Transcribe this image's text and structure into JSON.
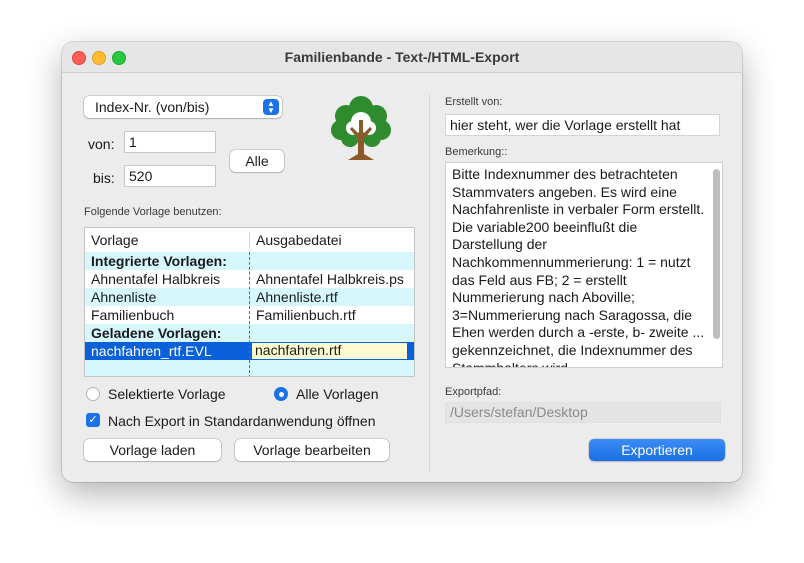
{
  "window": {
    "title": "Familienbande - Text-/HTML-Export"
  },
  "range": {
    "selector_value": "Index-Nr. (von/bis)",
    "von_label": "von:",
    "von_value": "1",
    "bis_label": "bis:",
    "bis_value": "520",
    "alle_label": "Alle"
  },
  "template_section": {
    "label": "Folgende Vorlage benutzen:",
    "columns": [
      "Vorlage",
      "Ausgabedatei"
    ],
    "rows": [
      {
        "vorlage": "Integrierte Vorlagen:",
        "ausgabe": ""
      },
      {
        "vorlage": "Ahnentafel Halbkreis",
        "ausgabe": "Ahnentafel Halbkreis.ps"
      },
      {
        "vorlage": "Ahnenliste",
        "ausgabe": "Ahnenliste.rtf"
      },
      {
        "vorlage": "Familienbuch",
        "ausgabe": "Familienbuch.rtf"
      },
      {
        "vorlage": "Geladene Vorlagen:",
        "ausgabe": ""
      },
      {
        "vorlage": "nachfahren_rtf.EVL",
        "ausgabe": "nachfahren.rtf"
      }
    ]
  },
  "options": {
    "radio_selected_label": "Selektierte Vorlage",
    "radio_all_label": "Alle Vorlagen",
    "checkbox_label": "Nach Export in Standardanwendung öffnen"
  },
  "buttons": {
    "load": "Vorlage laden",
    "edit": "Vorlage bearbeiten",
    "export": "Exportieren"
  },
  "right": {
    "created_by_label": "Erstellt von:",
    "created_by_value": "hier steht, wer die Vorlage erstellt hat",
    "remark_label": "Bemerkung::",
    "remark_text": "Bitte Indexnummer des betrachteten Stammvaters angeben. Es wird eine Nachfahrenliste in verbaler Form erstellt. Die variable200 beeinflußt die Darstellung der Nachkommennummerierung: 1 = nutzt das Feld aus FB; 2 = erstellt Nummerierung nach Aboville; 3=Nummerierung nach Saragossa, die Ehen werden durch a -erste, b- zweite ... gekennzeichnet, die Indexnummer des Stammhalters wird",
    "export_path_label": "Exportpfad:",
    "export_path_value": "/Users/stefan/Desktop"
  },
  "colors": {
    "accent": "#1a73e8",
    "selection": "#0a60d8",
    "group_row": "#d6f7fc",
    "tree_green": "#2e8b2e",
    "tree_trunk": "#8b5a2b"
  }
}
